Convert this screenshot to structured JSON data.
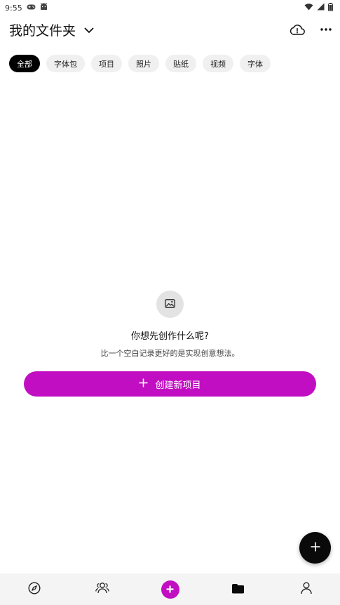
{
  "status_bar": {
    "time": "9:55",
    "left_icons": [
      "gamepad-icon",
      "android-icon"
    ],
    "right_icons": [
      "wifi-icon",
      "signal-icon",
      "battery-icon"
    ]
  },
  "header": {
    "title": "我的文件夹",
    "dropdown_icon": "chevron-down-icon",
    "actions": [
      "cloud-info-icon",
      "more-icon"
    ]
  },
  "filters": {
    "items": [
      {
        "label": "全部",
        "active": true
      },
      {
        "label": "字体包",
        "active": false
      },
      {
        "label": "项目",
        "active": false
      },
      {
        "label": "照片",
        "active": false
      },
      {
        "label": "贴纸",
        "active": false
      },
      {
        "label": "视频",
        "active": false
      },
      {
        "label": "字体",
        "active": false
      }
    ]
  },
  "empty_state": {
    "icon": "image-icon",
    "title": "你想先创作什么呢?",
    "subtitle": "比一个空白记录更好的是实现创意想法。"
  },
  "create_button": {
    "label": "创建新项目",
    "icon": "plus-icon"
  },
  "fab": {
    "icon": "plus-icon"
  },
  "bottom_nav": {
    "items": [
      {
        "icon": "compass-icon",
        "active": false
      },
      {
        "icon": "community-icon",
        "active": false
      },
      {
        "icon": "create-plus-icon",
        "active": false
      },
      {
        "icon": "folder-icon",
        "active": true
      },
      {
        "icon": "profile-icon",
        "active": false
      }
    ]
  },
  "colors": {
    "accent": "#c20ec2",
    "chip_bg": "#f0f0f0",
    "chip_active_bg": "#000000",
    "nav_bg": "#f4f4f4"
  }
}
